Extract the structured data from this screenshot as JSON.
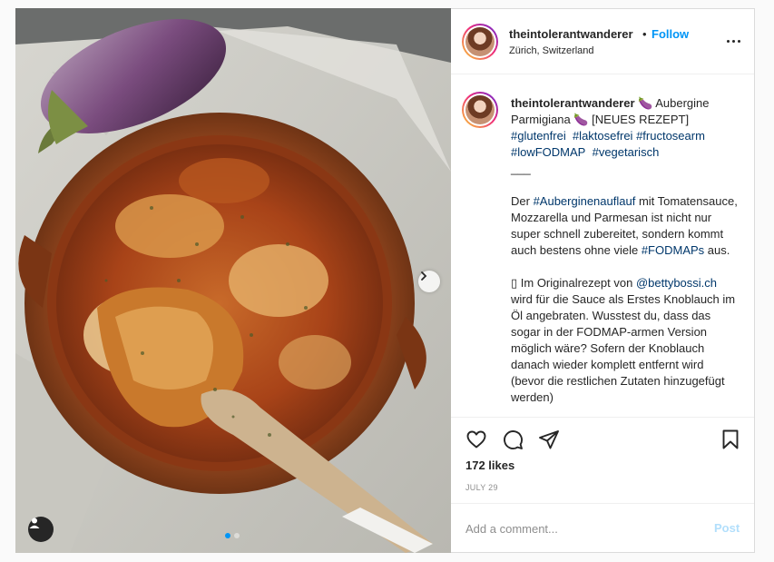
{
  "post": {
    "photo": {
      "slide_count": 2,
      "active_slide": 1,
      "next_icon": "chevron-right-icon",
      "user_tag_icon": "user-icon"
    },
    "header": {
      "username": "theintolerantwanderer",
      "separator": "•",
      "follow_label": "Follow",
      "location": "Zürich, Switzerland",
      "more_icon": "more-horizontal-icon"
    },
    "caption": {
      "username": "theintolerantwanderer",
      "title_emoji": "🍆",
      "title": " Aubergine Parmigiana ",
      "title_emoji2": "🍆",
      "title_suffix": " [NEUES REZEPT]",
      "hashtags": [
        "#glutenfrei",
        "#laktosefrei",
        "#fructosearm",
        "#lowFODMAP",
        "#vegetarisch"
      ],
      "divider": "___",
      "p1_start": "Der ",
      "p1_tag1": "#Auberginenauflauf",
      "p1_mid": " mit Tomatensauce, Mozzarella und Parmesan ist nicht nur super schnell zubereitet, sondern kommt auch bestens ohne viele ",
      "p1_tag2": "#FODMAPs",
      "p1_end": " aus.",
      "p2_glyph": "▯",
      "p2_start": " Im Originalrezept von ",
      "p2_mention": "@bettybossi.ch",
      "p2_end": " wird für die Sauce als Erstes Knoblauch im Öl angebraten. Wusstest du, dass das sogar in der FODMAP-armen Version möglich wäre? Sofern der Knoblauch danach wieder komplett entfernt wird (bevor die restlichen Zutaten hinzugefügt werden)"
    },
    "actions": {
      "like_icon": "heart-icon",
      "comment_icon": "comment-icon",
      "share_icon": "share-icon",
      "save_icon": "bookmark-icon",
      "likes": "172 likes",
      "date": "JULY 29"
    },
    "comment": {
      "placeholder": "Add a comment...",
      "post_label": "Post"
    },
    "colors": {
      "accent": "#0095f6",
      "post_disabled": "#b2dffc",
      "hashtag": "#00376b"
    }
  }
}
